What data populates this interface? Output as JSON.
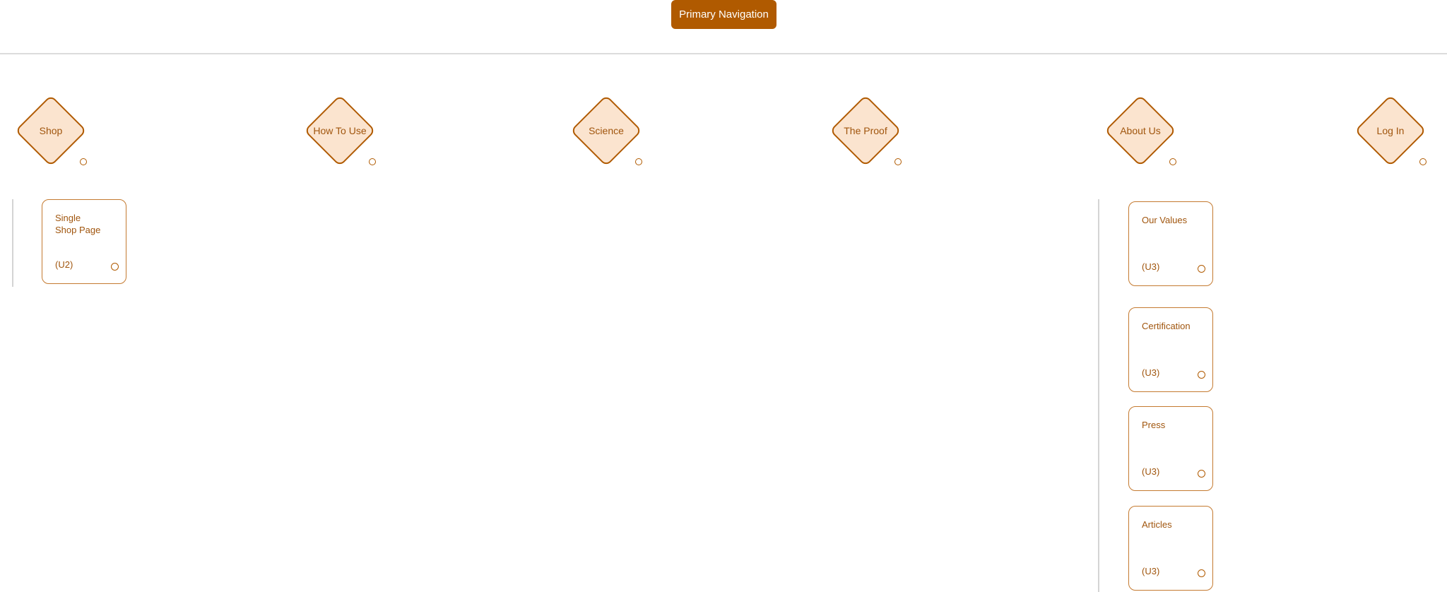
{
  "header": {
    "title": "Primary Navigation"
  },
  "colors": {
    "accent": "#b05a00",
    "node_fill": "#fbe4cf",
    "text": "#a0550d",
    "line": "#d4d4d4"
  },
  "nav_nodes": [
    {
      "label": "Shop"
    },
    {
      "label": "How To Use"
    },
    {
      "label": "Science"
    },
    {
      "label": "The Proof"
    },
    {
      "label": "About Us"
    },
    {
      "label": "Log In"
    }
  ],
  "shop_children": [
    {
      "title": "Single Shop Page",
      "code": "(U2)"
    }
  ],
  "about_children": [
    {
      "title": "Our Values",
      "code": "(U3)"
    },
    {
      "title": "Certification",
      "code": "(U3)"
    },
    {
      "title": "Press",
      "code": "(U3)"
    },
    {
      "title": "Articles",
      "code": "(U3)"
    }
  ]
}
